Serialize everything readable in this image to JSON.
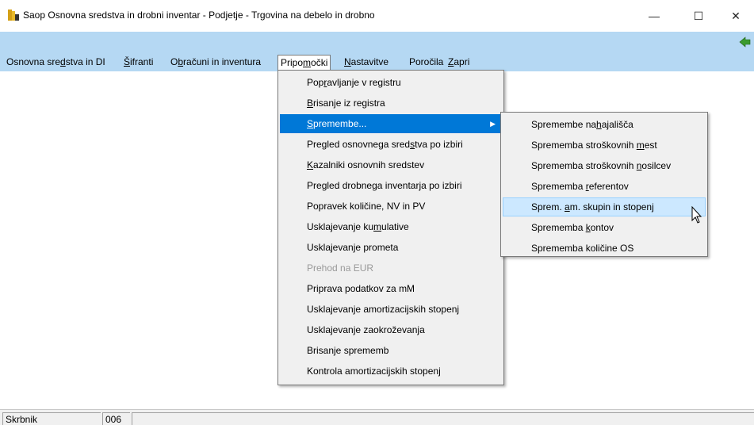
{
  "window": {
    "title": "Saop Osnovna sredstva in drobni inventar  - Podjetje - Trgovina na debelo in drobno",
    "minimize_glyph": "—",
    "maximize_glyph": "☐",
    "close_glyph": "✕"
  },
  "menubar": {
    "items": [
      {
        "pre": "Osnovna sre",
        "acc": "d",
        "post": "stva in DI"
      },
      {
        "pre": "",
        "acc": "Š",
        "post": "ifranti"
      },
      {
        "pre": "O",
        "acc": "b",
        "post": "računi in inventura"
      },
      {
        "pre": "Pripo",
        "acc": "m",
        "post": "očki"
      },
      {
        "pre": "",
        "acc": "N",
        "post": "astavitve"
      },
      {
        "pre": "Poročila",
        "acc": "",
        "post": ""
      },
      {
        "pre": "",
        "acc": "Z",
        "post": "apri"
      }
    ]
  },
  "dropdown": {
    "items": [
      {
        "pre": "Pop",
        "acc": "r",
        "post": "avljanje v registru",
        "state": "normal"
      },
      {
        "pre": "",
        "acc": "B",
        "post": "risanje iz registra",
        "state": "normal"
      },
      {
        "pre": "",
        "acc": "S",
        "post": "premembe...",
        "state": "highlight",
        "arrow": "▶"
      },
      {
        "pre": "Pregled osnovnega sred",
        "acc": "s",
        "post": "tva po izbiri",
        "state": "normal"
      },
      {
        "pre": "",
        "acc": "K",
        "post": "azalniki osnovnih sredstev",
        "state": "normal"
      },
      {
        "pre": "Pre",
        "acc": "g",
        "post": "led drobnega inventarja po izbiri",
        "state": "normal"
      },
      {
        "pre": "Popravek količine, NV in PV",
        "acc": "",
        "post": "",
        "state": "normal"
      },
      {
        "pre": "Usklajevanje ku",
        "acc": "m",
        "post": "ulative",
        "state": "normal"
      },
      {
        "pre": "Usklajevanje prometa",
        "acc": "",
        "post": "",
        "state": "normal"
      },
      {
        "pre": "Prehod na EUR",
        "acc": "",
        "post": "",
        "state": "disabled"
      },
      {
        "pre": "Priprava podatkov za mM",
        "acc": "",
        "post": "",
        "state": "normal"
      },
      {
        "pre": "Usklajevanje amortizacijskih stopenj",
        "acc": "",
        "post": "",
        "state": "normal"
      },
      {
        "pre": "Usklajevanje zaokroževanja",
        "acc": "",
        "post": "",
        "state": "normal"
      },
      {
        "pre": "Brisanje sprememb",
        "acc": "",
        "post": "",
        "state": "normal"
      },
      {
        "pre": "Kontrola amortizacijskih stopenj",
        "acc": "",
        "post": "",
        "state": "normal"
      }
    ]
  },
  "submenu": {
    "items": [
      {
        "pre": "Spremembe na",
        "acc": "h",
        "post": "ajališča",
        "state": "normal"
      },
      {
        "pre": "Sprememba stroškovnih ",
        "acc": "m",
        "post": "est",
        "state": "normal"
      },
      {
        "pre": "Sprememba stroškovnih ",
        "acc": "n",
        "post": "osilcev",
        "state": "normal"
      },
      {
        "pre": "Sprememba ",
        "acc": "r",
        "post": "eferentov",
        "state": "normal"
      },
      {
        "pre": "Sprem. ",
        "acc": "a",
        "post": "m. skupin in stopenj",
        "state": "highlight"
      },
      {
        "pre": "Sprememba ",
        "acc": "k",
        "post": "ontov",
        "state": "normal"
      },
      {
        "pre": "Sprememba količine OS",
        "acc": "",
        "post": "",
        "state": "normal"
      }
    ]
  },
  "statusbar": {
    "label": "Skrbnik",
    "value": "006",
    "extra": ""
  },
  "colors": {
    "menubar_bg": "#b5d8f3",
    "menu_bg": "#f0f0f0",
    "highlight": "#0078d7",
    "hover": "#cce8ff"
  }
}
